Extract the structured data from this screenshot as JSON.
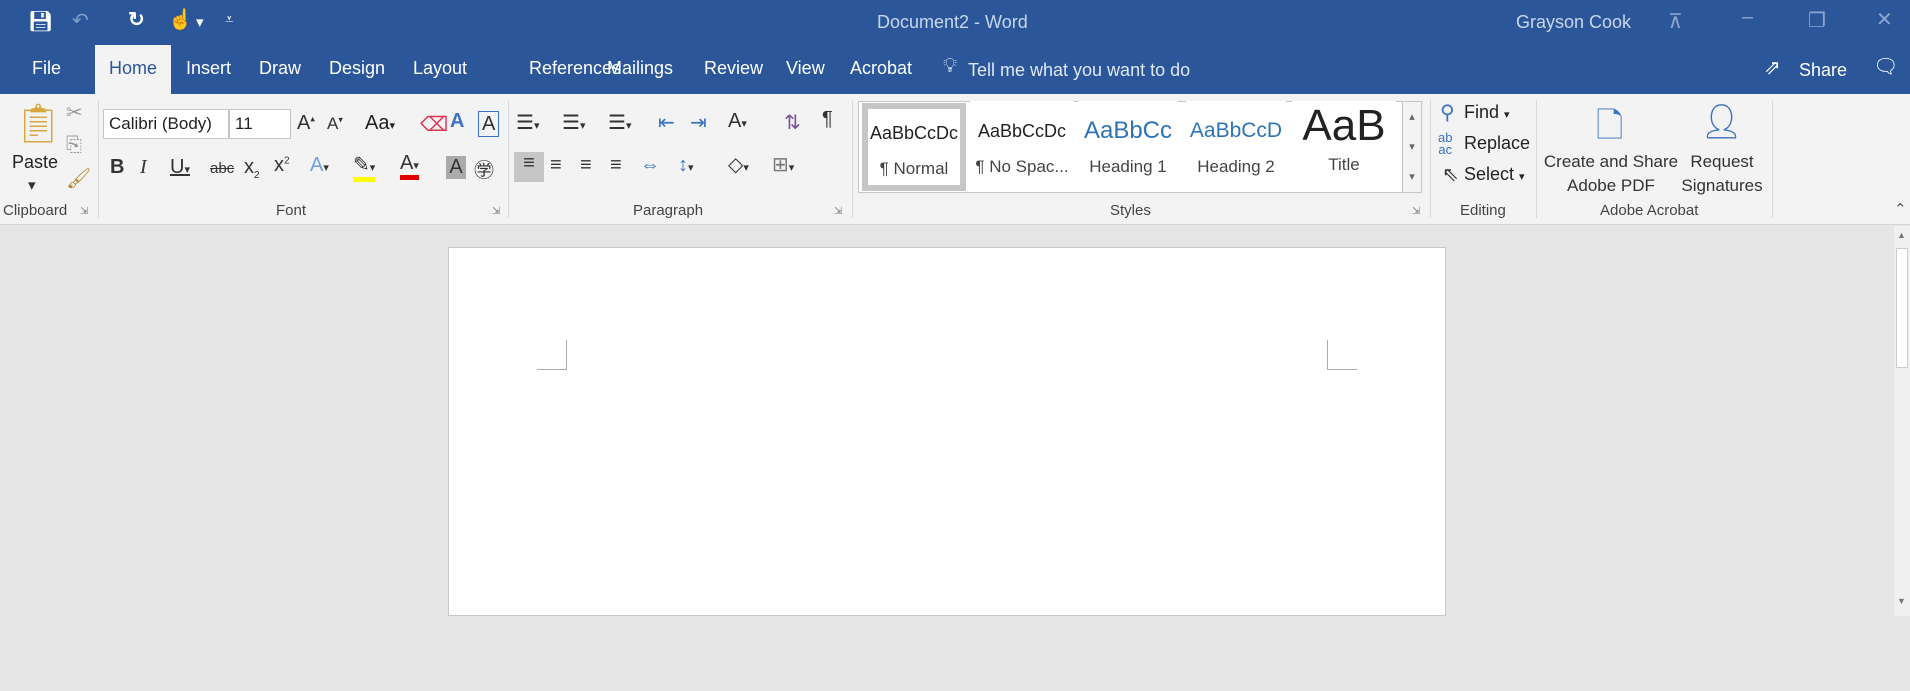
{
  "titlebar": {
    "title": "Document2  -  Word",
    "user": "Grayson Cook"
  },
  "tabs": [
    "File",
    "Home",
    "Insert",
    "Draw",
    "Design",
    "Layout",
    "References",
    "Mailings",
    "Review",
    "View",
    "Acrobat"
  ],
  "tell_me": "Tell me what you want to do",
  "share": "Share",
  "clipboard": {
    "paste": "Paste",
    "label": "Clipboard"
  },
  "font": {
    "name": "Calibri (Body)",
    "size": "11",
    "label": "Font",
    "case": "Aa"
  },
  "paragraph": {
    "label": "Paragraph"
  },
  "styles": {
    "label": "Styles",
    "items": [
      {
        "sample": "AaBbCcDc",
        "name": "¶ Normal"
      },
      {
        "sample": "AaBbCcDc",
        "name": "¶ No Spac..."
      },
      {
        "sample": "AaBbCc",
        "name": "Heading 1"
      },
      {
        "sample": "AaBbCcD",
        "name": "Heading 2"
      },
      {
        "sample": "AaB",
        "name": "Title"
      }
    ]
  },
  "editing": {
    "find": "Find",
    "replace": "Replace",
    "select": "Select",
    "label": "Editing"
  },
  "acrobat": {
    "create": "Create and Share Adobe PDF",
    "request": "Request Signatures",
    "label": "Adobe Acrobat"
  },
  "colors": {
    "accent": "#2b579a",
    "highlight": "#ffff00",
    "font_color": "#e00000"
  }
}
